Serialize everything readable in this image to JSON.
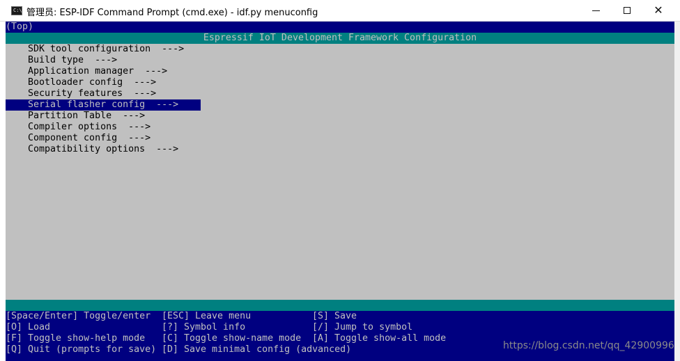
{
  "window": {
    "icon_text": "C:\\",
    "title": "管理员: ESP-IDF Command Prompt (cmd.exe) - idf.py  menuconfig"
  },
  "menuconfig": {
    "breadcrumb": "(Top)",
    "header": "Espressif IoT Development Framework Configuration",
    "items": [
      {
        "label": "SDK tool configuration  --->"
      },
      {
        "label": "Build type  --->"
      },
      {
        "label": "Application manager  --->"
      },
      {
        "label": "Bootloader config  --->"
      },
      {
        "label": "Security features  --->"
      },
      {
        "label": "Serial flasher config  --->"
      },
      {
        "label": "Partition Table  --->"
      },
      {
        "label": "Compiler options  --->"
      },
      {
        "label": "Component config  --->"
      },
      {
        "label": "Compatibility options  --->"
      }
    ],
    "selected_index": 5,
    "help": [
      [
        "[Space/Enter] Toggle/enter",
        "[ESC] Leave menu",
        "[S] Save"
      ],
      [
        "[O] Load",
        "[?] Symbol info",
        "[/] Jump to symbol"
      ],
      [
        "[F] Toggle show-help mode",
        "[C] Toggle show-name mode",
        "[A] Toggle show-all mode"
      ],
      [
        "[Q] Quit (prompts for save)",
        "[D] Save minimal config (advanced)",
        ""
      ]
    ]
  },
  "watermark": "https://blog.csdn.net/qq_42900996",
  "colors": {
    "background": "#c0c0c0",
    "header": "#008080",
    "selection": "#000080"
  }
}
